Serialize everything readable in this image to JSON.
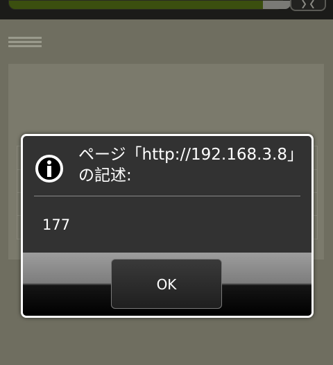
{
  "dialog": {
    "title": "ページ「http://192.168.3.8」の記述:",
    "message": "177",
    "ok_label": "OK",
    "icon": "info-icon"
  },
  "colors": {
    "dialog_bg": "#323232",
    "dialog_border": "#ffffff",
    "page_overlay": "#6f6e60",
    "urlbar_green": "#3b4f0f"
  }
}
